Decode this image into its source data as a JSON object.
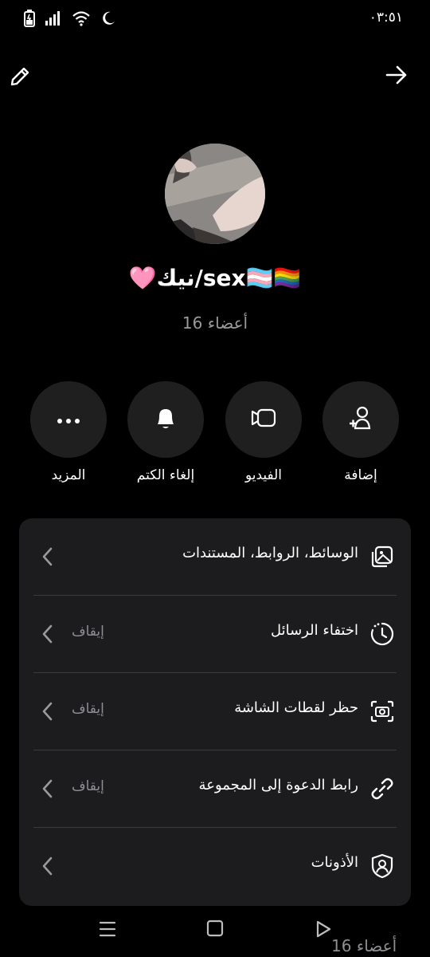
{
  "status_bar": {
    "time": "٠٣:٥١",
    "icons": [
      "battery-charging-icon",
      "signal-icon",
      "wifi-icon",
      "moon-icon"
    ]
  },
  "header": {
    "edit_icon": "pencil-icon",
    "forward_icon": "arrow-right-icon"
  },
  "group": {
    "name": "🩷نيك/sex🏳️‍⚧️🏳️‍🌈",
    "members": "16 أعضاء"
  },
  "actions": [
    {
      "label": "إضافة",
      "icon": "add-member-icon"
    },
    {
      "label": "الفيديو",
      "icon": "video-icon"
    },
    {
      "label": "إلغاء الكتم",
      "icon": "bell-icon"
    },
    {
      "label": "المزيد",
      "icon": "more-icon"
    }
  ],
  "settings": [
    {
      "label": "الوسائط، الروابط، المستندات",
      "value": "",
      "icon": "media-icon"
    },
    {
      "label": "اختفاء الرسائل",
      "value": "إيقاف",
      "icon": "timer-icon"
    },
    {
      "label": "حظر لقطات الشاشة",
      "value": "إيقاف",
      "icon": "screenshot-icon"
    },
    {
      "label": "رابط الدعوة إلى المجموعة",
      "value": "إيقاف",
      "icon": "link-icon"
    },
    {
      "label": "الأذونات",
      "value": "",
      "icon": "shield-user-icon"
    }
  ],
  "bottom": {
    "members": "16 أعضاء"
  },
  "colors": {
    "background": "#000000",
    "card": "#1c1c1e",
    "button_circle": "#1f1f1f",
    "muted_text": "#8e8e93"
  }
}
